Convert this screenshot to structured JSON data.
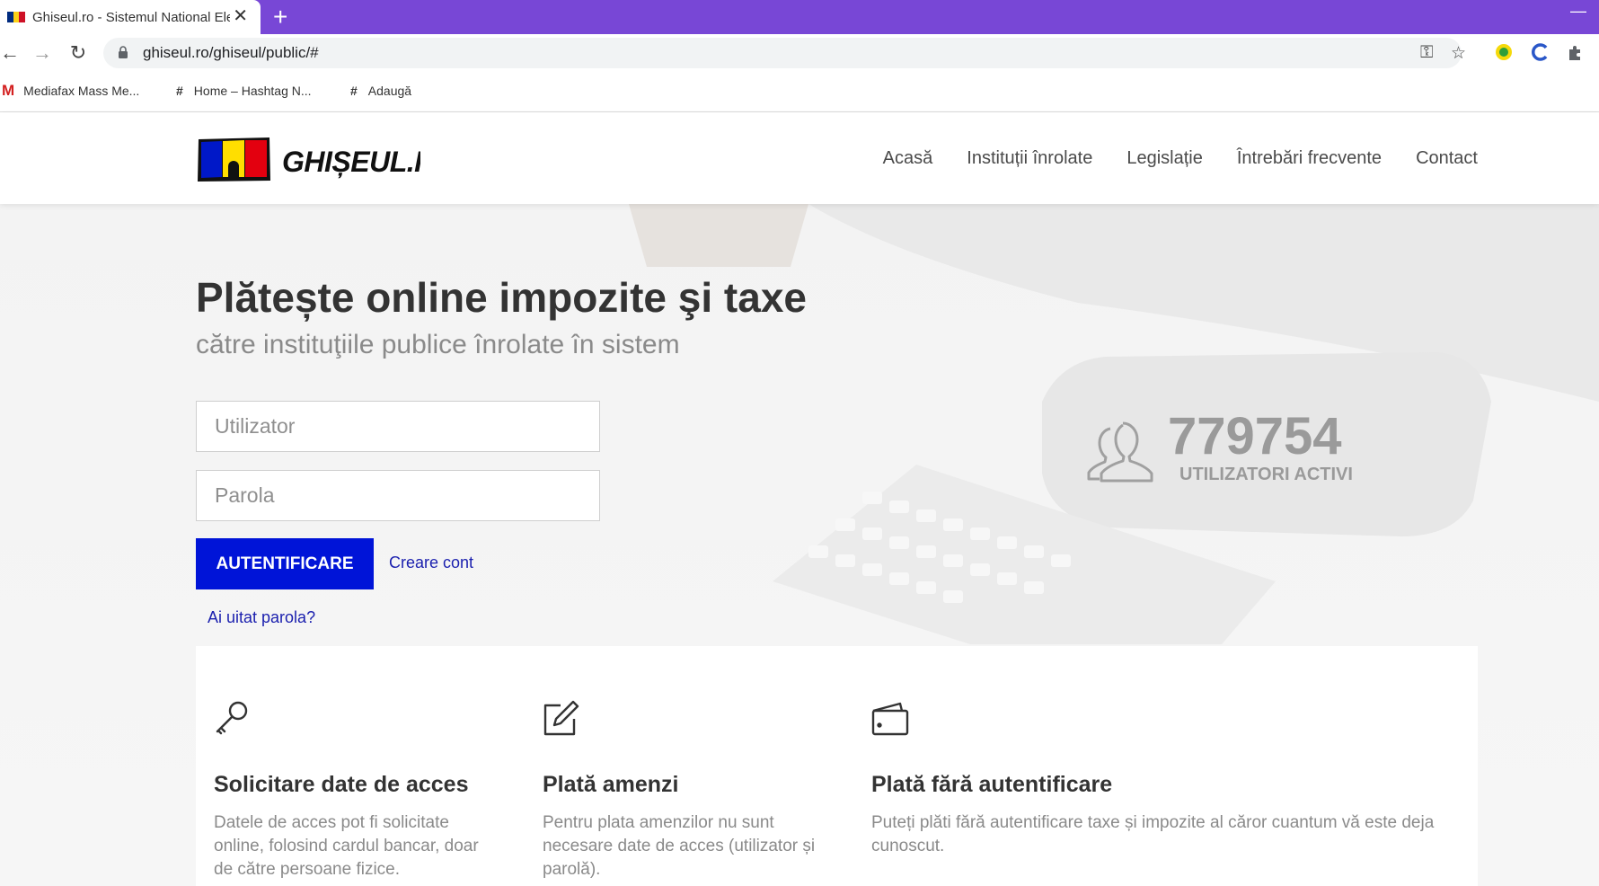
{
  "browser": {
    "tab_title": "Ghiseul.ro - Sistemul National Ele",
    "url": "ghiseul.ro/ghiseul/public/#",
    "bookmarks": [
      {
        "icon": "M",
        "label": "Mediafax Mass Me..."
      },
      {
        "icon": "#",
        "label": "Home – Hashtag N..."
      },
      {
        "icon": "#",
        "label": "Adaugă"
      }
    ]
  },
  "site": {
    "logo_text": "GHIȘEUL.Ro",
    "nav": [
      "Acasă",
      "Instituții înrolate",
      "Legislație",
      "Întrebări frecvente",
      "Contact"
    ]
  },
  "hero": {
    "title": "Plătește online impozite şi taxe",
    "subtitle": "către instituţiile publice înrolate în sistem",
    "username_placeholder": "Utilizator",
    "password_placeholder": "Parola",
    "login_label": "AUTENTIFICARE",
    "create_account": "Creare cont",
    "forgot_password": "Ai uitat parola?",
    "users_count": "779754",
    "users_label": "UTILIZATORI ACTIVI"
  },
  "features": [
    {
      "icon": "key-icon",
      "title": "Solicitare date de acces",
      "text": "Datele de acces pot fi solicitate online, folosind cardul bancar, doar de către persoane fizice."
    },
    {
      "icon": "edit-icon",
      "title": "Plată amenzi",
      "text": "Pentru plata amenzilor nu sunt necesare date de acces (utilizator și parolă)."
    },
    {
      "icon": "wallet-icon",
      "title": "Plată fără autentificare",
      "text": "Puteți plăti fără autentificare taxe și impozite al căror cuantum vă este deja cunoscut."
    }
  ],
  "colors": {
    "tabbar": "#7847d6",
    "primary_button": "#0014d8",
    "link": "#1a1fae",
    "flag": [
      "#002b7f",
      "#fcd116",
      "#ce1126"
    ]
  }
}
